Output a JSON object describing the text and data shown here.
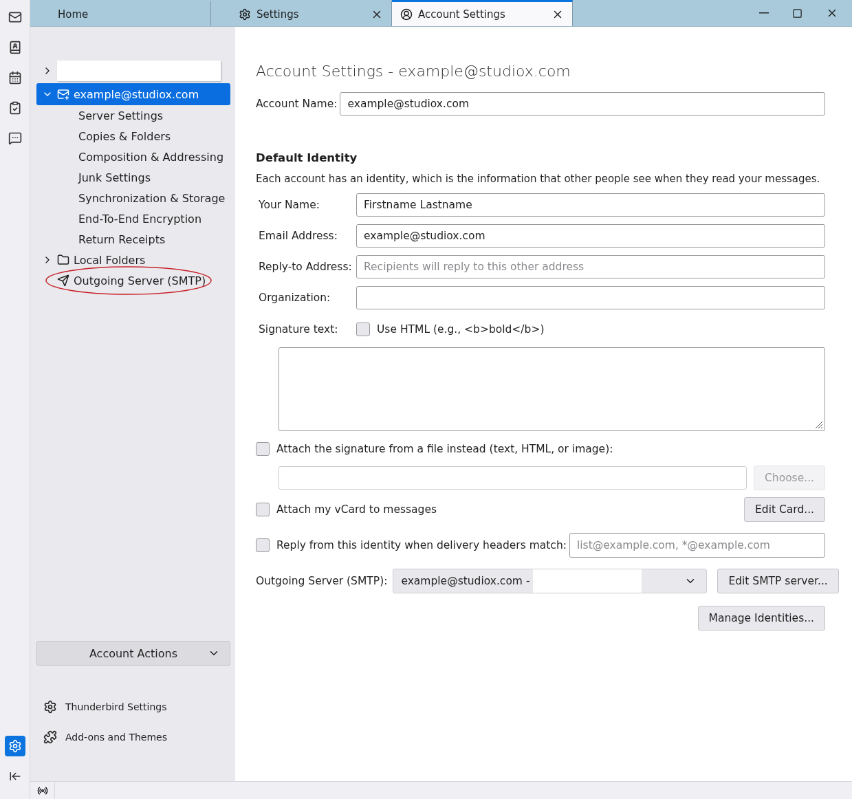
{
  "spaces_bar": {
    "items": [
      {
        "kind": "mail",
        "selected": false
      },
      {
        "kind": "contacts",
        "selected": false
      },
      {
        "kind": "calendar",
        "selected": false
      },
      {
        "kind": "tasks",
        "selected": false
      },
      {
        "kind": "chat",
        "selected": false
      }
    ],
    "bottom": [
      {
        "kind": "settings",
        "selected": true
      },
      {
        "kind": "collapse",
        "selected": false
      }
    ]
  },
  "tabs": [
    {
      "kind": "home",
      "label": "Home",
      "selected": false,
      "closable": false
    },
    {
      "kind": "settings",
      "label": "Settings",
      "selected": false,
      "closable": true
    },
    {
      "kind": "account",
      "label": "Account Settings",
      "selected": true,
      "closable": true
    }
  ],
  "sidebar": {
    "accounts": [
      {
        "kind": "redacted",
        "expanded": false,
        "selected": false
      },
      {
        "kind": "mail",
        "label": "example@studiox.com",
        "expanded": true,
        "selected": true,
        "children": [
          {
            "label": "Server Settings"
          },
          {
            "label": "Copies & Folders"
          },
          {
            "label": "Composition & Addressing"
          },
          {
            "label": "Junk Settings"
          },
          {
            "label": "Synchronization & Storage"
          },
          {
            "label": "End-To-End Encryption"
          },
          {
            "label": "Return Receipts"
          }
        ]
      },
      {
        "kind": "folder",
        "label": "Local Folders",
        "expanded": false,
        "selected": false
      },
      {
        "kind": "smtp",
        "label": "Outgoing Server (SMTP)",
        "selected": false,
        "circled": true
      }
    ],
    "account_actions": {
      "label": "Account Actions"
    },
    "links": [
      {
        "kind": "settings",
        "label": "Thunderbird Settings"
      },
      {
        "kind": "addons",
        "label": "Add-ons and Themes"
      }
    ]
  },
  "main": {
    "title": "Account Settings - example@studiox.com",
    "account_name": {
      "label": "Account Name:",
      "value": "example@studiox.com"
    },
    "identity_heading": "Default Identity",
    "identity_description": "Each account has an identity, which is the information that other people see when they read your messages.",
    "identity_fields": [
      {
        "label": "Your Name:",
        "value": "Firstname Lastname"
      },
      {
        "label": "Email Address:",
        "value": "example@studiox.com"
      },
      {
        "label": "Reply-to Address:",
        "placeholder": "Recipients will reply to this other address"
      },
      {
        "label": "Organization:"
      }
    ],
    "signature": {
      "label": "Signature text:",
      "use_html": {
        "label": "Use HTML (e.g., <b>bold</b>)",
        "checked": false
      }
    },
    "attach_file": {
      "label": "Attach the signature from a file instead (text, HTML, or image):",
      "checked": false,
      "button": {
        "label": "Choose...",
        "disabled": true
      }
    },
    "vcard": {
      "label": "Attach my vCard to messages",
      "checked": false,
      "button": {
        "label": "Edit Card...",
        "disabled": false
      }
    },
    "reply_from": {
      "label": "Reply from this identity when delivery headers match:",
      "checked": false,
      "placeholder": "list@example.com, *@example.com"
    },
    "smtp": {
      "label": "Outgoing Server (SMTP):",
      "value": "example@studiox.com -",
      "button": {
        "label": "Edit SMTP server...",
        "disabled": false
      }
    },
    "manage_button": {
      "label": "Manage Identities...",
      "disabled": false
    }
  }
}
